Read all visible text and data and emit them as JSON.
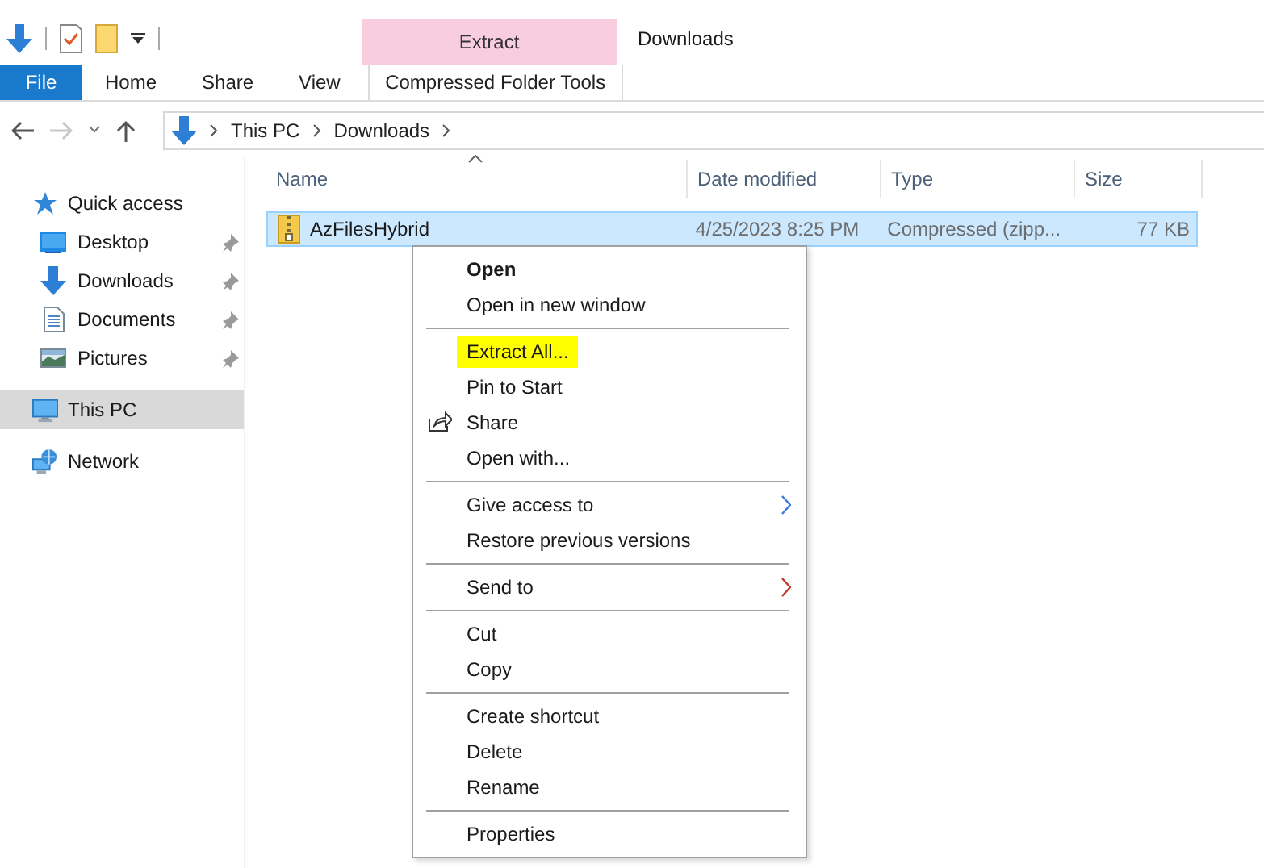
{
  "window": {
    "title": "Downloads"
  },
  "contextual_tab_group": {
    "label": "Extract"
  },
  "ribbon_tabs": [
    {
      "label": "File",
      "kind": "file"
    },
    {
      "label": "Home",
      "kind": "normal"
    },
    {
      "label": "Share",
      "kind": "normal"
    },
    {
      "label": "View",
      "kind": "normal"
    },
    {
      "label": "Compressed Folder Tools",
      "kind": "contextual"
    }
  ],
  "address_bar": {
    "path": [
      "This PC",
      "Downloads"
    ]
  },
  "sidebar": {
    "items": [
      {
        "label": "Quick access",
        "kind": "star",
        "selected": false,
        "children": [
          {
            "label": "Desktop",
            "kind": "desktop",
            "pinned": true,
            "selected": false
          },
          {
            "label": "Downloads",
            "kind": "downloads",
            "pinned": true,
            "selected": false
          },
          {
            "label": "Documents",
            "kind": "documents",
            "pinned": true,
            "selected": false
          },
          {
            "label": "Pictures",
            "kind": "pictures",
            "pinned": true,
            "selected": false
          }
        ]
      },
      {
        "label": "This PC",
        "kind": "computer",
        "selected": true
      },
      {
        "label": "Network",
        "kind": "network",
        "selected": false
      }
    ]
  },
  "file_list": {
    "columns": [
      {
        "label": "Name",
        "sorted": true
      },
      {
        "label": "Date modified",
        "sorted": false
      },
      {
        "label": "Type",
        "sorted": false
      },
      {
        "label": "Size",
        "sorted": false
      }
    ],
    "rows": [
      {
        "name": "AzFilesHybrid",
        "date_modified": "4/25/2023 8:25 PM",
        "type": "Compressed (zipp...",
        "size": "77 KB",
        "selected": true
      }
    ]
  },
  "context_menu": {
    "sections": [
      {
        "items": [
          {
            "label": "Open",
            "kind": "plain",
            "default": true,
            "highlighted": false
          },
          {
            "label": "Open in new window",
            "kind": "plain",
            "default": false,
            "highlighted": false
          }
        ]
      },
      {
        "items": [
          {
            "label": "Extract All...",
            "kind": "plain",
            "default": false,
            "highlighted": true
          },
          {
            "label": "Pin to Start",
            "kind": "plain",
            "default": false,
            "highlighted": false
          },
          {
            "label": "Share",
            "kind": "share",
            "default": false,
            "highlighted": false
          },
          {
            "label": "Open with...",
            "kind": "plain",
            "default": false,
            "highlighted": false
          }
        ]
      },
      {
        "items": [
          {
            "label": "Give access to",
            "kind": "submenu",
            "color": "#3c78d8",
            "default": false,
            "highlighted": false
          },
          {
            "label": "Restore previous versions",
            "kind": "plain",
            "default": false,
            "highlighted": false
          }
        ]
      },
      {
        "items": [
          {
            "label": "Send to",
            "kind": "submenu",
            "color": "#c0392b",
            "default": false,
            "highlighted": false
          }
        ]
      },
      {
        "items": [
          {
            "label": "Cut",
            "kind": "plain",
            "default": false,
            "highlighted": false
          },
          {
            "label": "Copy",
            "kind": "plain",
            "default": false,
            "highlighted": false
          }
        ]
      },
      {
        "items": [
          {
            "label": "Create shortcut",
            "kind": "plain",
            "default": false,
            "highlighted": false
          },
          {
            "label": "Delete",
            "kind": "plain",
            "default": false,
            "highlighted": false
          },
          {
            "label": "Rename",
            "kind": "plain",
            "default": false,
            "highlighted": false
          }
        ]
      },
      {
        "items": [
          {
            "label": "Properties",
            "kind": "plain",
            "default": false,
            "highlighted": false
          }
        ]
      }
    ]
  }
}
